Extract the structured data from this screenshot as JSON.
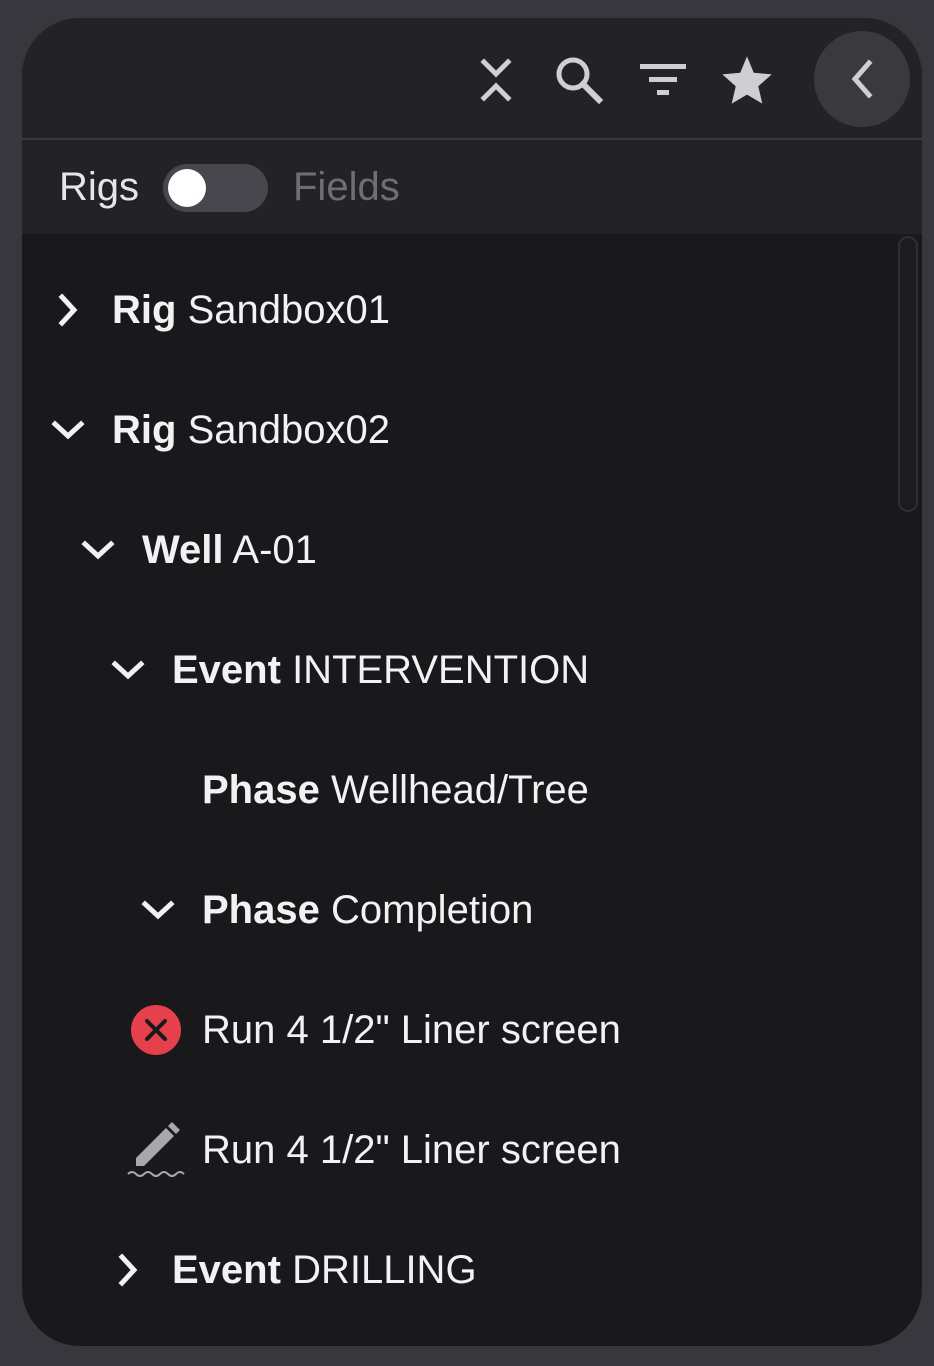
{
  "toolbar": {
    "icons": [
      "collapse-all-icon",
      "search-icon",
      "filter-icon",
      "star-icon",
      "chevron-left-icon"
    ]
  },
  "toggle": {
    "left_label": "Rigs",
    "right_label": "Fields",
    "state": "left"
  },
  "tree": {
    "rows": [
      {
        "kind": "Rig",
        "name": "Sandbox01",
        "expander": "collapsed"
      },
      {
        "kind": "Rig",
        "name": "Sandbox02",
        "expander": "expanded"
      },
      {
        "kind": "Well",
        "name": "A-01",
        "expander": "expanded"
      },
      {
        "kind": "Event",
        "name": "INTERVENTION",
        "expander": "expanded"
      },
      {
        "kind": "Phase",
        "name": "Wellhead/Tree",
        "expander": "none"
      },
      {
        "kind": "Phase",
        "name": "Completion",
        "expander": "expanded"
      },
      {
        "text": "Run 4 1/2\" Liner screen",
        "status_icon": "error-icon",
        "status_color": "#e5404b"
      },
      {
        "text": "Run 4 1/2\" Liner screen",
        "status_icon": "pencil-icon"
      },
      {
        "kind": "Event",
        "name": "DRILLING",
        "expander": "collapsed"
      }
    ]
  },
  "colors": {
    "background": "#38373d",
    "panel": "#19191b",
    "header": "#232326",
    "text": "#f2f2f4",
    "muted": "#6f6e74",
    "error": "#e5404b"
  }
}
